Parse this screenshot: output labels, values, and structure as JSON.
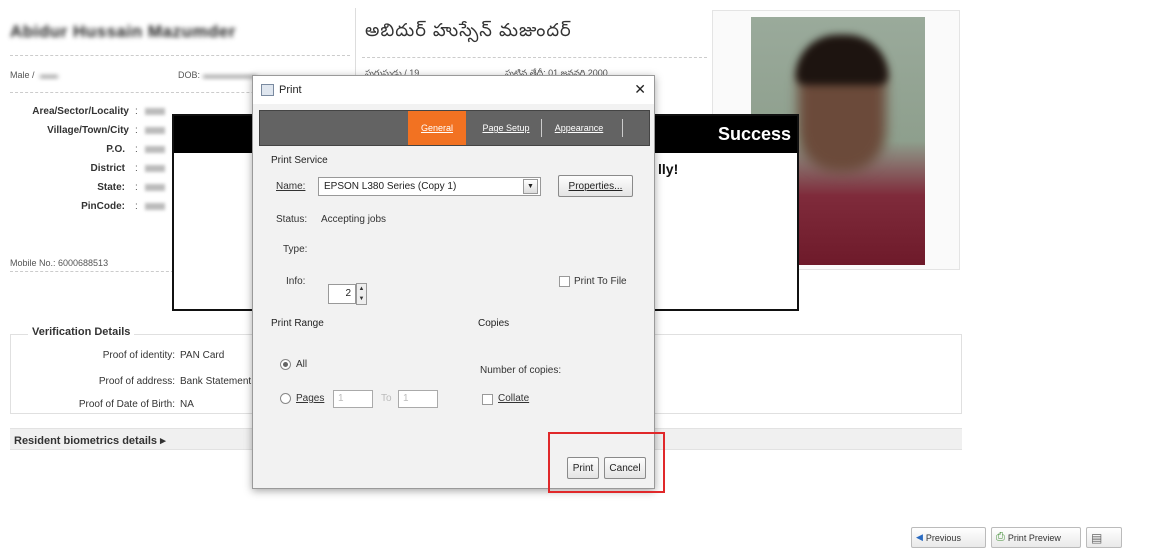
{
  "profile": {
    "name_en": "Abidur Hussain Mazumder",
    "name_te": "అబిదుర్ హుస్సేన్ మజుందర్",
    "gender_label": "Male /",
    "dob_label": "DOB:",
    "te_gender": "పురుషుడు / 19",
    "te_dob": "పుట్టిన తేదీ: 01 జనవరి 2000",
    "fields": [
      {
        "label": "Area/Sector/Locality"
      },
      {
        "label": "Village/Town/City"
      },
      {
        "label": "P.O."
      },
      {
        "label": "District"
      },
      {
        "label": "State:"
      },
      {
        "label": "PinCode:"
      }
    ],
    "mobile": "Mobile No.: 6000688513"
  },
  "success": {
    "title": "Success",
    "message": "lly!"
  },
  "verification": {
    "title": "Verification Details",
    "rows": [
      {
        "label": "Proof of identity:",
        "value": "PAN Card"
      },
      {
        "label": "Proof of address:",
        "value": "Bank Statement"
      },
      {
        "label": "Proof of Date of Birth:",
        "value": "NA"
      }
    ]
  },
  "biometrics": {
    "label": "Resident biometrics details ▸"
  },
  "bottom_buttons": {
    "previous": "Previous",
    "print_preview": "Print Preview"
  },
  "dialog": {
    "title": "Print",
    "close": "✕",
    "tabs": [
      "General",
      "Page Setup",
      "Appearance"
    ],
    "print_service": {
      "section": "Print Service",
      "name_label": "Name:",
      "printer": "EPSON L380 Series (Copy 1)",
      "properties_button": "Properties...",
      "status_label": "Status:",
      "status_value": "Accepting jobs",
      "type_label": "Type:",
      "info_label": "Info:",
      "print_to_file": "Print To File"
    },
    "print_range": {
      "section": "Print Range",
      "all": "All",
      "pages": "Pages",
      "from": "1",
      "to_label": "To",
      "to": "1"
    },
    "copies": {
      "section": "Copies",
      "number_label": "Number of copies:",
      "number": "2",
      "collate": "Collate"
    },
    "print_button": "Print",
    "cancel_button": "Cancel"
  }
}
